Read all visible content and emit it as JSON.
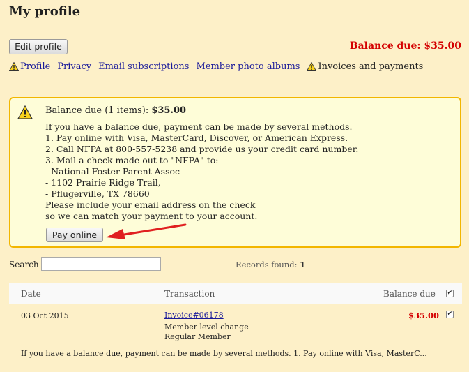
{
  "page": {
    "title": "My profile"
  },
  "toolbar": {
    "edit_label": "Edit profile",
    "balance_label": "Balance due: $35.00"
  },
  "tabs": [
    {
      "label": "Profile",
      "warn": true,
      "link": true
    },
    {
      "label": "Privacy",
      "warn": false,
      "link": true
    },
    {
      "label": "Email subscriptions",
      "warn": false,
      "link": true
    },
    {
      "label": "Member photo albums",
      "warn": false,
      "link": true
    },
    {
      "label": "Invoices and payments",
      "warn": true,
      "link": false
    }
  ],
  "notice": {
    "head_label": "Balance due (1 items): ",
    "head_amount": "$35.00",
    "lines": [
      "If you have a balance due, payment can be made by several methods.",
      "1. Pay online with Visa, MasterCard, Discover, or American Express.",
      "2. Call NFPA at 800-557-5238 and provide us your credit card number.",
      "3. Mail a check made out to \"NFPA\" to:",
      "- National Foster Parent Assoc",
      "- 1102 Prairie Ridge Trail,",
      "- Pflugerville, TX 78660",
      "Please include your email address on the check",
      "so we can match your payment to your account."
    ],
    "pay_label": "Pay online"
  },
  "search": {
    "label": "Search",
    "value": "",
    "records_label": "Records found: ",
    "records_count": "1"
  },
  "table": {
    "headers": {
      "date": "Date",
      "transaction": "Transaction",
      "balance": "Balance due"
    },
    "rows": [
      {
        "date": "03 Oct 2015",
        "invoice": "Invoice#06178",
        "line1": "Member level change",
        "line2": "Regular Member",
        "balance": "$35.00",
        "checked": true,
        "description": "If you have a balance due, payment can be made by several methods. 1. Pay online with Visa, MasterC..."
      }
    ]
  },
  "colors": {
    "background": "#fdf0c8",
    "alert_red": "#d40000",
    "notice_border": "#f2b600",
    "link": "#1a1a9a"
  },
  "icons": {
    "warning": "warning-triangle-icon",
    "annotation": "red-arrow-icon"
  }
}
